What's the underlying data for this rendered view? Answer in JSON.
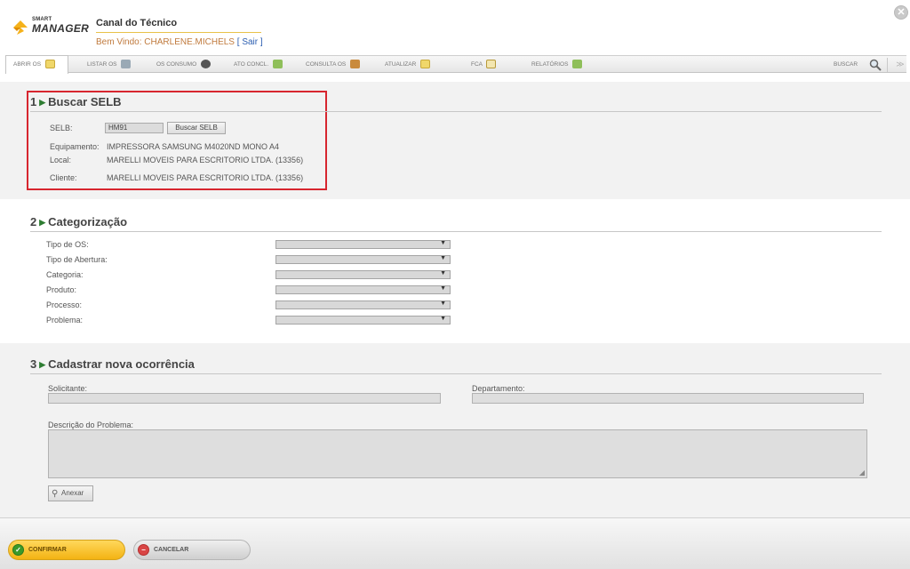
{
  "header": {
    "logo_small": "SMART",
    "logo_big": "MANAGER",
    "title": "Canal do Técnico",
    "welcome": "Bem Vindo: CHARLENE.MICHELS",
    "logout_open": "[ ",
    "logout": "Sair",
    "logout_close": " ]",
    "close_symbol": "✕"
  },
  "toolbar": {
    "tabs": [
      {
        "label": "ABRIR OS",
        "icon": "edit-icon"
      },
      {
        "label": "LISTAR OS",
        "icon": "tools-icon"
      },
      {
        "label": "OS CONSUMO",
        "icon": "gear-icon"
      },
      {
        "label": "ATO CONCL.",
        "icon": "grid-icon"
      },
      {
        "label": "CONSULTA OS",
        "icon": "box-icon"
      },
      {
        "label": "ATUALIZAR",
        "icon": "edit-icon"
      },
      {
        "label": "FCA",
        "icon": "clipboard-icon"
      },
      {
        "label": "RELATÓRIOS",
        "icon": "grid-icon"
      }
    ],
    "search_label": "BUSCAR",
    "toggle_symbol": "≫"
  },
  "section1": {
    "number": "1",
    "title": "Buscar SELB",
    "selb_label": "SELB:",
    "selb_value": "HM91",
    "search_button": "Buscar SELB",
    "equipment_label": "Equipamento:",
    "equipment_value": "IMPRESSORA SAMSUNG M4020ND MONO A4",
    "local_label": "Local:",
    "local_value": "MARELLI MOVEIS PARA ESCRITORIO LTDA. (13356)",
    "client_label": "Cliente:",
    "client_value": "MARELLI MOVEIS PARA ESCRITORIO LTDA. (13356)"
  },
  "section2": {
    "number": "2",
    "title": "Categorização",
    "fields": [
      {
        "label": "Tipo de OS:",
        "value": ""
      },
      {
        "label": "Tipo de Abertura:",
        "value": ""
      },
      {
        "label": "Categoria:",
        "value": ""
      },
      {
        "label": "Produto:",
        "value": ""
      },
      {
        "label": "Processo:",
        "value": ""
      },
      {
        "label": "Problema:",
        "value": ""
      }
    ]
  },
  "section3": {
    "number": "3",
    "title": "Cadastrar nova ocorrência",
    "requester_label": "Solicitante:",
    "requester_value": "",
    "department_label": "Departamento:",
    "department_value": "",
    "description_label": "Descrição do Problema:",
    "description_value": "",
    "attach_button": "Anexar"
  },
  "footer": {
    "confirm": "CONFIRMAR",
    "cancel": "CANCELAR"
  },
  "colors": {
    "highlight": "#d7262f",
    "accent_yellow": "#f3b313",
    "section_bg": "#f2f2f2"
  }
}
